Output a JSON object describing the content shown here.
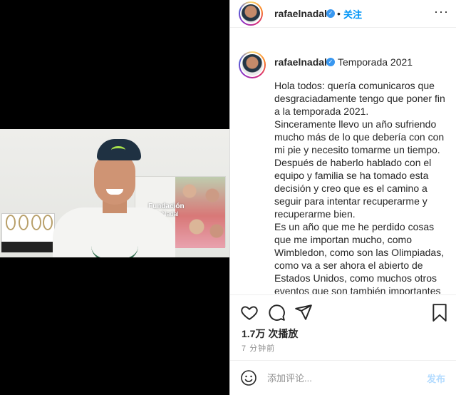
{
  "header": {
    "username": "rafaelnadal",
    "verified_icon": "verified-badge-icon",
    "separator": "•",
    "follow_label": "关注",
    "more_icon": "more-options-icon",
    "more_label": "···"
  },
  "caption": {
    "username": "rafaelnadal",
    "title": "Temporada 2021",
    "paragraphs": [
      "Hola todos: quería comunicaros que desgraciadamente tengo que poner fin a la temporada 2021.",
      "Sinceramente llevo un año sufriendo mucho más de lo que debería con con mi pie y necesito tomarme un tiempo.",
      "Después de haberlo hablado con el equipo y familia se ha tomado esta decisión y creo que es el camino a seguir para intentar recuperarme y recuperarme bien.",
      "Es un año que me he perdido cosas que me importan mucho, como Wimbledon, como son las Olimpiadas, como va a ser ahora el abierto de Estados Unidos, como muchos otros eventos que son también importantes"
    ]
  },
  "media": {
    "poster_text_line1": "Fundación",
    "poster_text_line2": "RafaNadal"
  },
  "actions": {
    "like_icon": "heart-icon",
    "comment_icon": "comment-bubble-icon",
    "share_icon": "paper-plane-icon",
    "save_icon": "bookmark-icon",
    "views": "1.7万 次播放",
    "time": "7 分钟前"
  },
  "comment": {
    "emoji_icon": "smiley-icon",
    "placeholder": "添加评论...",
    "post_label": "发布"
  },
  "colors": {
    "accent": "#0095f6",
    "verified": "#3897f0",
    "post_disabled": "#b3dbff",
    "muted": "#8e8e8e"
  }
}
